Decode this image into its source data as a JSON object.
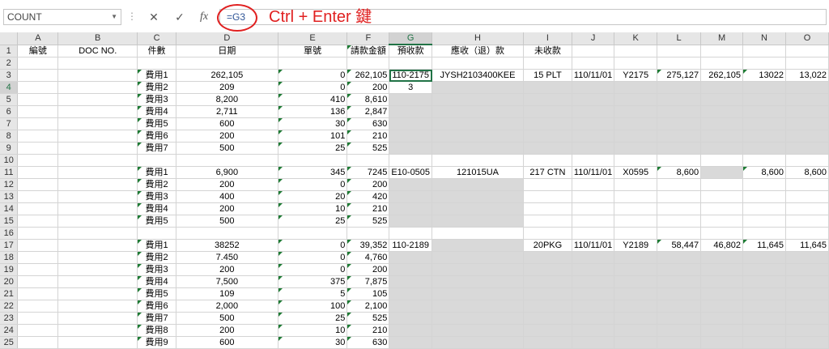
{
  "name_box": "COUNT",
  "formula_bar": {
    "cancel_icon": "✕",
    "enter_icon": "✓",
    "fx_label": "fx",
    "content": "=G3"
  },
  "hint": "Ctrl + Enter 鍵",
  "columns": [
    "A",
    "B",
    "C",
    "D",
    "E",
    "F",
    "G",
    "H",
    "I",
    "J",
    "K",
    "L",
    "M",
    "N",
    "O"
  ],
  "rows": [
    {
      "n": "1",
      "cells": [
        "編號",
        "DOC NO.",
        "件數",
        "日期",
        "單號",
        "請款金額",
        "預收款",
        "應收（退）款",
        "未收款",
        "",
        "",
        "",
        "",
        "",
        ""
      ]
    },
    {
      "n": "2",
      "cells": [
        "",
        "",
        "",
        "",
        "",
        "",
        "",
        "",
        "",
        "",
        "",
        "",
        "",
        "",
        ""
      ]
    },
    {
      "n": "3",
      "cells": [
        "",
        "",
        "費用1",
        "262,105",
        "0",
        "262,105",
        "110-2175",
        "JYSH2103400KEE",
        "15 PLT",
        "110/11/01",
        "Y2175",
        "275,127",
        "262,105",
        "13022",
        "13,022"
      ]
    },
    {
      "n": "4",
      "cells": [
        "",
        "",
        "費用2",
        "209",
        "0",
        "200",
        "3",
        "",
        "",
        "",
        "",
        "",
        "",
        "",
        ""
      ]
    },
    {
      "n": "5",
      "cells": [
        "",
        "",
        "費用3",
        "8,200",
        "410",
        "8,610",
        "",
        "",
        "",
        "",
        "",
        "",
        "",
        "",
        ""
      ]
    },
    {
      "n": "6",
      "cells": [
        "",
        "",
        "費用4",
        "2,711",
        "136",
        "2,847",
        "",
        "",
        "",
        "",
        "",
        "",
        "",
        "",
        ""
      ]
    },
    {
      "n": "7",
      "cells": [
        "",
        "",
        "費用5",
        "600",
        "30",
        "630",
        "",
        "",
        "",
        "",
        "",
        "",
        "",
        "",
        ""
      ]
    },
    {
      "n": "8",
      "cells": [
        "",
        "",
        "費用6",
        "200",
        "101",
        "210",
        "",
        "",
        "",
        "",
        "",
        "",
        "",
        "",
        ""
      ]
    },
    {
      "n": "9",
      "cells": [
        "",
        "",
        "費用7",
        "500",
        "25",
        "525",
        "",
        "",
        "",
        "",
        "",
        "",
        "",
        "",
        ""
      ]
    },
    {
      "n": "10",
      "cells": [
        "",
        "",
        "",
        "",
        "",
        "",
        "",
        "",
        "",
        "",
        "",
        "",
        "",
        "",
        ""
      ]
    },
    {
      "n": "11",
      "cells": [
        "",
        "",
        "費用1",
        "6,900",
        "345",
        "7245",
        "E10-0505",
        "121015UA",
        "217 CTN",
        "110/11/01",
        "X0595",
        "8,600",
        "",
        "8,600",
        "8,600"
      ]
    },
    {
      "n": "12",
      "cells": [
        "",
        "",
        "費用2",
        "200",
        "0",
        "200",
        "",
        "",
        "",
        "",
        "",
        "",
        "",
        "",
        ""
      ]
    },
    {
      "n": "13",
      "cells": [
        "",
        "",
        "費用3",
        "400",
        "20",
        "420",
        "",
        "",
        "",
        "",
        "",
        "",
        "",
        "",
        ""
      ]
    },
    {
      "n": "14",
      "cells": [
        "",
        "",
        "費用4",
        "200",
        "10",
        "210",
        "",
        "",
        "",
        "",
        "",
        "",
        "",
        "",
        ""
      ]
    },
    {
      "n": "15",
      "cells": [
        "",
        "",
        "費用5",
        "500",
        "25",
        "525",
        "",
        "",
        "",
        "",
        "",
        "",
        "",
        "",
        ""
      ]
    },
    {
      "n": "16",
      "cells": [
        "",
        "",
        "",
        "",
        "",
        "",
        "",
        "",
        "",
        "",
        "",
        "",
        "",
        "",
        ""
      ]
    },
    {
      "n": "17",
      "cells": [
        "",
        "",
        "費用1",
        "38252",
        "0",
        "39,352",
        "110-2189",
        "",
        "20PKG",
        "110/11/01",
        "Y2189",
        "58,447",
        "46,802",
        "11,645",
        "11,645"
      ]
    },
    {
      "n": "18",
      "cells": [
        "",
        "",
        "費用2",
        "7.450",
        "0",
        "4,760",
        "",
        "",
        "",
        "",
        "",
        "",
        "",
        "",
        ""
      ]
    },
    {
      "n": "19",
      "cells": [
        "",
        "",
        "費用3",
        "200",
        "0",
        "200",
        "",
        "",
        "",
        "",
        "",
        "",
        "",
        "",
        ""
      ]
    },
    {
      "n": "20",
      "cells": [
        "",
        "",
        "費用4",
        "7,500",
        "375",
        "7,875",
        "",
        "",
        "",
        "",
        "",
        "",
        "",
        "",
        ""
      ]
    },
    {
      "n": "21",
      "cells": [
        "",
        "",
        "費用5",
        "109",
        "5",
        "105",
        "",
        "",
        "",
        "",
        "",
        "",
        "",
        "",
        ""
      ]
    },
    {
      "n": "22",
      "cells": [
        "",
        "",
        "費用6",
        "2,000",
        "100",
        "2,100",
        "",
        "",
        "",
        "",
        "",
        "",
        "",
        "",
        ""
      ]
    },
    {
      "n": "23",
      "cells": [
        "",
        "",
        "費用7",
        "500",
        "25",
        "525",
        "",
        "",
        "",
        "",
        "",
        "",
        "",
        "",
        ""
      ]
    },
    {
      "n": "24",
      "cells": [
        "",
        "",
        "費用8",
        "200",
        "10",
        "210",
        "",
        "",
        "",
        "",
        "",
        "",
        "",
        "",
        ""
      ]
    },
    {
      "n": "25",
      "cells": [
        "",
        "",
        "費用9",
        "600",
        "30",
        "630",
        "",
        "",
        "",
        "",
        "",
        "",
        "",
        "",
        ""
      ]
    }
  ],
  "colors": {
    "accent": "#217346",
    "hint": "#e02020",
    "fill": "#d9d9d9",
    "marker": "#1e7b34"
  }
}
